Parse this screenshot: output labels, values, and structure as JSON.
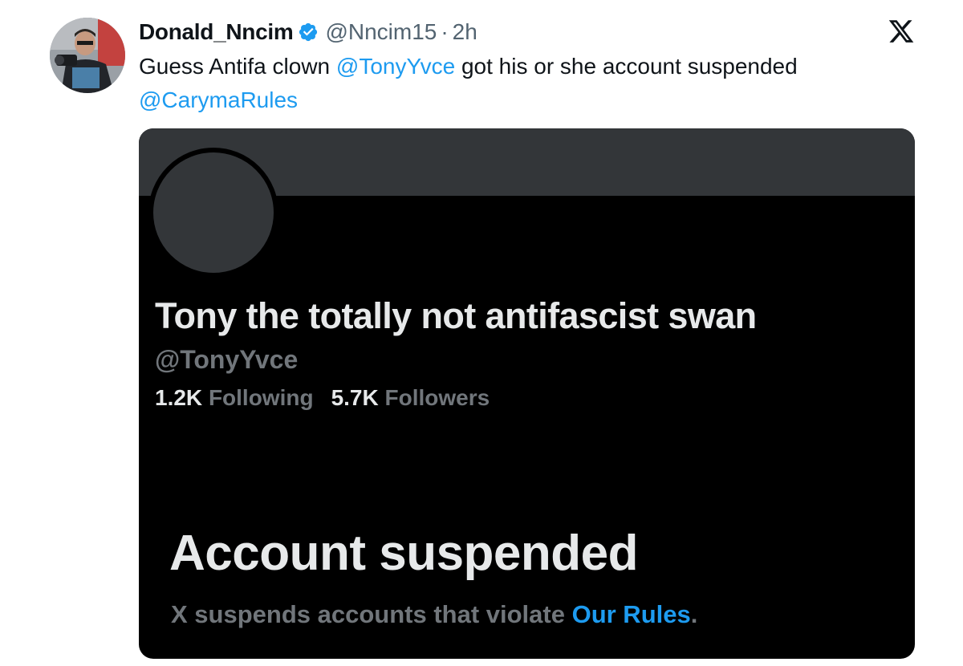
{
  "tweet": {
    "author_name": "Donald_Nncim",
    "handle": "@Nncim15",
    "separator": "·",
    "time": "2h",
    "text_before": "Guess Antifa clown ",
    "mention_1": "@TonyYvce",
    "text_after": " got his or she account suspended",
    "mention_2": "@CarymaRules"
  },
  "card": {
    "profile_name": "Tony the totally not antifascist swan",
    "profile_handle": "@TonyYvce",
    "following_count": "1.2K",
    "following_label": "Following",
    "followers_count": "5.7K",
    "followers_label": "Followers",
    "suspended_title": "Account suspended",
    "suspended_text": "X suspends accounts that violate ",
    "rules_link": "Our Rules",
    "suspended_end": "."
  },
  "icons": {
    "verified": "verified-badge-icon",
    "platform": "x-logo-icon"
  },
  "colors": {
    "link": "#1d9bf0",
    "text": "#0f1419",
    "muted": "#536471",
    "card_bg": "#000000",
    "banner": "#333639"
  }
}
